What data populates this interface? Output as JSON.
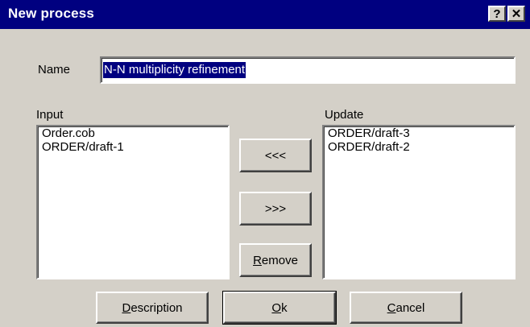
{
  "window": {
    "title": "New process",
    "help_label": "?",
    "close_label": "✕"
  },
  "name": {
    "label": "Name",
    "value": "N-N multiplicity refinement"
  },
  "input": {
    "label": "Input",
    "items": [
      "Order.cob",
      "ORDER/draft-1"
    ]
  },
  "update": {
    "label": "Update",
    "items": [
      "ORDER/draft-3",
      "ORDER/draft-2"
    ]
  },
  "buttons": {
    "move_left": "<<<",
    "move_right": ">>>",
    "remove_mnemonic": "R",
    "remove_rest": "emove",
    "description_mnemonic": "D",
    "description_rest": "escription",
    "ok_mnemonic": "O",
    "ok_rest": "k",
    "cancel_mnemonic": "C",
    "cancel_rest": "ancel"
  },
  "colors": {
    "titlebar": "#000080",
    "face": "#d4d0c8",
    "selection": "#000080"
  }
}
